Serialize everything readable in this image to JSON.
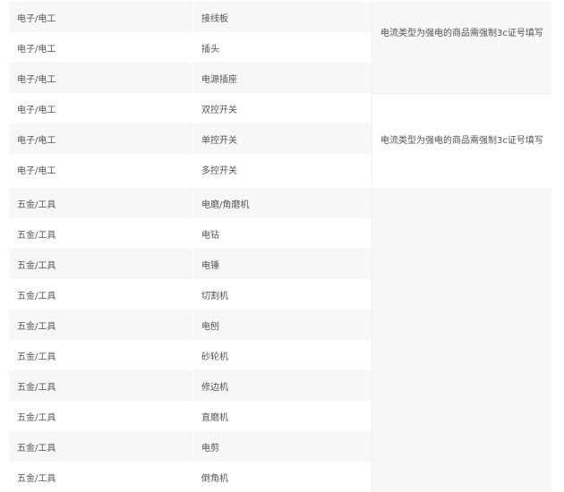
{
  "rows_group1": [
    {
      "category": "电子/电工",
      "product": "接线板"
    },
    {
      "category": "电子/电工",
      "product": "插头"
    },
    {
      "category": "电子/电工",
      "product": "电源插座"
    }
  ],
  "rows_group2": [
    {
      "category": "电子/电工",
      "product": "双控开关"
    },
    {
      "category": "电子/电工",
      "product": "单控开关"
    },
    {
      "category": "电子/电工",
      "product": "多控开关"
    }
  ],
  "rows_group3": [
    {
      "category": "五金/工具",
      "product": "电磨/角磨机"
    },
    {
      "category": "五金/工具",
      "product": "电钻"
    },
    {
      "category": "五金/工具",
      "product": "电锤"
    },
    {
      "category": "五金/工具",
      "product": "切割机"
    },
    {
      "category": "五金/工具",
      "product": "电刨"
    },
    {
      "category": "五金/工具",
      "product": "砂轮机"
    },
    {
      "category": "五金/工具",
      "product": "修边机"
    },
    {
      "category": "五金/工具",
      "product": "直磨机"
    },
    {
      "category": "五金/工具",
      "product": "电剪"
    },
    {
      "category": "五金/工具",
      "product": "倒角机"
    }
  ],
  "notes": {
    "group1": "电流类型为强电的商品需强制3c证号填写",
    "group2": "电流类型为强电的商品需强制3c证号填写",
    "group3": ""
  }
}
